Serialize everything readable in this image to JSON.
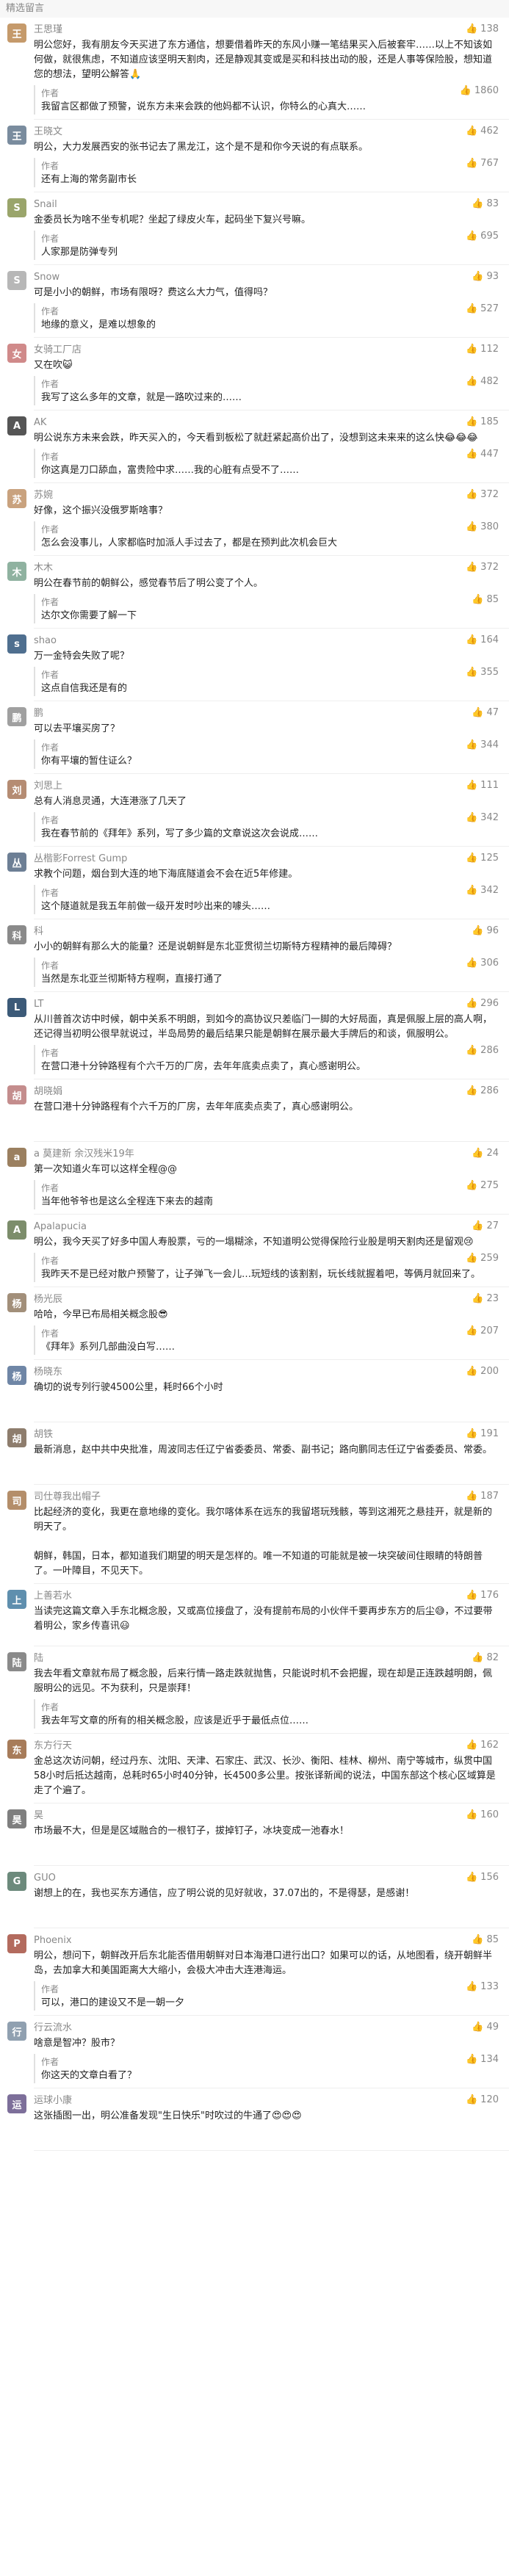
{
  "section_title": "精选留言",
  "comments": [
    {
      "nick": "王思瑾",
      "likes": "138",
      "avatar_color": "#c59a6b",
      "text": "明公您好，我有朋友今天买进了东方通信，想要借着昨天的东风小赚一笔结果买入后被套牢……以上不知该如何做，就很焦虑，不知道应该坚明天割肉，还是静观其变或是买和科技出动的股，还是人事等保险股，想知道您的想法，望明公解答🙏",
      "reply_label": "作者",
      "reply_likes": "1860",
      "reply": "我留言区都做了预警，说东方未来会跌的他妈都不认识，你特么的心真大……"
    },
    {
      "nick": "王晓文",
      "likes": "462",
      "avatar_color": "#7a8c9e",
      "text": "明公，大力发展西安的张书记去了黑龙江，这个是不是和你今天说的有点联系。",
      "reply_label": "作者",
      "reply_likes": "767",
      "reply": "还有上海的常务副市长"
    },
    {
      "nick": "Snail",
      "likes": "83",
      "avatar_color": "#9aa56b",
      "text": "金委员长为啥不坐专机呢？坐起了绿皮火车，起码坐下复兴号嘛。",
      "reply_label": "作者",
      "reply_likes": "695",
      "reply": "人家那是防弹专列"
    },
    {
      "nick": "Snow",
      "likes": "93",
      "avatar_color": "#b7b7b7",
      "text": "可是小小的朝鲜，市场有限呀？费这么大力气，值得吗？",
      "reply_label": "作者",
      "reply_likes": "527",
      "reply": "地缘的意义，是难以想象的"
    },
    {
      "nick": "女骑工厂店",
      "likes": "112",
      "avatar_color": "#d08a8a",
      "text": "又在吹😺",
      "reply_label": "作者",
      "reply_likes": "482",
      "reply": "我写了这么多年的文章，就是一路吹过来的……"
    },
    {
      "nick": "AK",
      "likes": "185",
      "avatar_color": "#555555",
      "text": "明公说东方未来会跌，昨天买入的，今天看到板松了就赶紧起高价出了，没想到这未来来的这么快😂😂😂",
      "reply_label": "作者",
      "reply_likes": "447",
      "reply": "你这真是刀口舔血，富贵险中求……我的心脏有点受不了……"
    },
    {
      "nick": "苏婉",
      "likes": "372",
      "avatar_color": "#c9a27e",
      "text": "好像，这个振兴没俄罗斯啥事？",
      "reply_label": "作者",
      "reply_likes": "380",
      "reply": "怎么会没事儿，人家都临时加派人手过去了，都是在预判此次机会巨大"
    },
    {
      "nick": "木木",
      "likes": "372",
      "avatar_color": "#8fb2a0",
      "text": "明公在春节前的朝鲜公，感觉春节后了明公变了个人。",
      "reply_label": "作者",
      "reply_likes": "85",
      "reply": "达尔文你需要了解一下"
    },
    {
      "nick": "shao",
      "likes": "164",
      "avatar_color": "#4f6f8f",
      "text": "万一金特会失败了呢？",
      "reply_label": "作者",
      "reply_likes": "355",
      "reply": "这点自信我还是有的"
    },
    {
      "nick": "鹏",
      "likes": "47",
      "avatar_color": "#a0a0a0",
      "text": "可以去平壤买房了？",
      "reply_label": "作者",
      "reply_likes": "344",
      "reply": "你有平壤的暂住证么？"
    },
    {
      "nick": "刘思上",
      "likes": "111",
      "avatar_color": "#b58c73",
      "text": "总有人消息灵通，大连港涨了几天了",
      "reply_label": "作者",
      "reply_likes": "342",
      "reply": "我在春节前的《拜年》系列，写了多少篇的文章说这次会说成……"
    },
    {
      "nick": "丛楷影Forrest Gump",
      "likes": "125",
      "avatar_color": "#6d7f95",
      "text": "求教个问题，烟台到大连的地下海底隧道会不会在近5年修建。",
      "reply_label": "作者",
      "reply_likes": "342",
      "reply": "这个隧道就是我五年前做一级开发时吵出来的噱头……"
    },
    {
      "nick": "科",
      "likes": "96",
      "avatar_color": "#8a8a8a",
      "text": "小小的朝鲜有那么大的能量？还是说朝鲜是东北亚贯彻兰切斯特方程精神的最后障碍？",
      "reply_label": "作者",
      "reply_likes": "306",
      "reply": "当然是东北亚兰彻斯特方程啊，直接打通了"
    },
    {
      "nick": "LT",
      "likes": "296",
      "avatar_color": "#3c5a78",
      "text": "从川普首次访中时候，朝中关系不明朗，到如今的高协议只差临门一脚的大好局面，真是佩服上层的高人啊，还记得当初明公很早就说过，半岛局势的最后结果只能是朝鲜在展示最大手牌后的和谈，佩服明公。",
      "reply_label": "作者",
      "reply_likes": "286",
      "reply": "在营口港十分钟路程有个六千万的厂房，去年年底卖点卖了，真心感谢明公。"
    },
    {
      "nick": "胡晓娟",
      "likes": "286",
      "avatar_color": "#c48d8d",
      "text": "在营口港十分钟路程有个六千万的厂房，去年年底卖点卖了，真心感谢明公。",
      "reply_label": "",
      "reply_likes": "",
      "reply": ""
    },
    {
      "nick": "a 莫建新 余汉残米19年",
      "likes": "24",
      "avatar_color": "#9b8060",
      "text": "第一次知道火车可以这样全程@@",
      "reply_label": "作者",
      "reply_likes": "275",
      "reply": "当年他爷爷也是这么全程连下来去的越南"
    },
    {
      "nick": "Apalapucia",
      "likes": "27",
      "avatar_color": "#7c8d6b",
      "text": "明公，我今天买了好多中国人寿股票，亏的一塌糊涂，不知道明公觉得保险行业股是明天割肉还是留观😢",
      "reply_label": "作者",
      "reply_likes": "259",
      "reply": "我昨天不是已经对散户预警了，让子弹飞一会儿…玩短线的该割割，玩长线就握着吧，等俩月就回来了。"
    },
    {
      "nick": "杨光辰",
      "likes": "23",
      "avatar_color": "#a28f7a",
      "text": "哈哈，今早已布局相关概念股😎",
      "reply_label": "作者",
      "reply_likes": "207",
      "reply": "《拜年》系列几部曲没白写……"
    },
    {
      "nick": "杨晓东",
      "likes": "200",
      "avatar_color": "#6f86a6",
      "text": "确切的说专列行驶4500公里，耗时66个小时",
      "reply_label": "",
      "reply_likes": "",
      "reply": ""
    },
    {
      "nick": "胡铁",
      "likes": "191",
      "avatar_color": "#8e7d6d",
      "text": "最新消息，赵中共中央批准，周波同志任辽宁省委委员、常委、副书记；路向鹏同志任辽宁省委委员、常委。",
      "reply_label": "",
      "reply_likes": "",
      "reply": ""
    },
    {
      "nick": "司仕尊我出帽子",
      "likes": "187",
      "avatar_color": "#b48e6a",
      "text": "比起经济的变化，我更在意地缘的变化。我尔喀体系在远东的我留塔玩残骸，等到这湘死之悬挂开，就是新的明天了。\n\n朝鲜，韩国，日本，都知道我们期望的明天是怎样的。唯一不知道的可能就是被一块突破间住眼睛的特朗普了。一叶障目，不见天下。",
      "reply_label": "",
      "reply_likes": "",
      "reply": ""
    },
    {
      "nick": "上善若水",
      "likes": "176",
      "avatar_color": "#5f8fae",
      "text": "当读完这篇文章入手东北概念股，又或高位接盘了，没有提前布局的小伙伴千要再步东方的后尘😅，不过要带着明公，家乡传喜讯😃",
      "reply_label": "",
      "reply_likes": "",
      "reply": ""
    },
    {
      "nick": "陆",
      "likes": "82",
      "avatar_color": "#8a8a8a",
      "text": "我去年看文章就布局了概念股，后来行情一路走跌就抛售，只能说时机不会把握，现在却是正连跌越明朗，佩服明公的远见。不为获利，只是崇拜！",
      "reply_label": "作者",
      "reply_likes": "",
      "reply": "我去年写文章的所有的相关概念股，应该是近乎于最低点位……"
    },
    {
      "nick": "东方行天",
      "likes": "162",
      "avatar_color": "#a77c5a",
      "text": "金总这次访问朝，经过丹东、沈阳、天津、石家庄、武汉、长沙、衡阳、桂林、柳州、南宁等城市，纵贯中国58小时后抵达越南，总耗时65小时40分钟，长4500多公里。按张译新闻的说法，中国东部这个核心区域算是走了个遍了。",
      "reply_label": "",
      "reply_likes": "",
      "reply": ""
    },
    {
      "nick": "昊",
      "likes": "160",
      "avatar_color": "#7f7f7f",
      "text": "市场最不大，但是是区域融合的一根钉子，拔掉钉子，冰块变成一池春水！",
      "reply_label": "",
      "reply_likes": "",
      "reply": ""
    },
    {
      "nick": "GUO",
      "likes": "156",
      "avatar_color": "#6c8a7c",
      "text": "谢想上的在，我也买东方通信，应了明公说的见好就收，37.07出的，不是得瑟，是感谢！",
      "reply_label": "",
      "reply_likes": "",
      "reply": ""
    },
    {
      "nick": "Phoenix",
      "likes": "85",
      "avatar_color": "#b36b5e",
      "text": "明公，想问下，朝鲜改开后东北能否借用朝鲜对日本海港口进行出口？如果可以的话，从地图看，绕开朝鲜半岛，去加拿大和美国距离大大缩小，会极大冲击大连港海运。",
      "reply_label": "作者",
      "reply_likes": "133",
      "reply": "可以，港口的建设又不是一朝一夕"
    },
    {
      "nick": "行云流水",
      "likes": "49",
      "avatar_color": "#90a0b0",
      "text": "啥意是智冲？股市？",
      "reply_label": "作者",
      "reply_likes": "134",
      "reply": "你这天的文章白看了？"
    },
    {
      "nick": "运球小康",
      "likes": "120",
      "avatar_color": "#7d6f9a",
      "text": "这张插图一出，明公准备发现\"生日快乐\"时吹过的牛通了😍😍😍",
      "reply_label": "",
      "reply_likes": "",
      "reply": ""
    }
  ]
}
